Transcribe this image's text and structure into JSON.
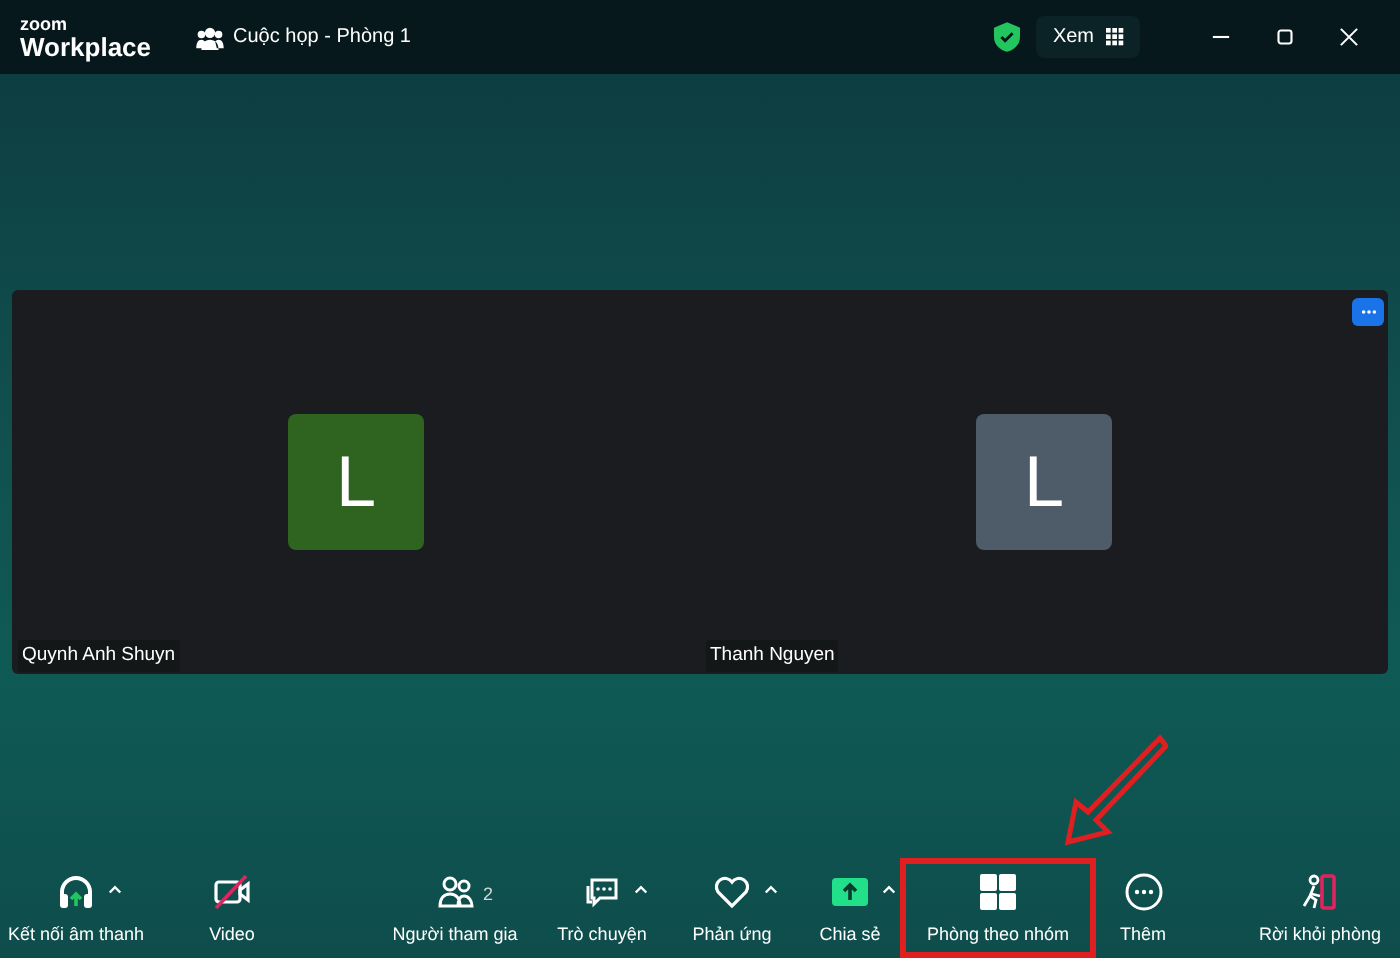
{
  "app": {
    "logo_top": "zoom",
    "logo_bottom": "Workplace",
    "meeting_title": "Cuộc họp - Phòng 1",
    "view_button": "Xem"
  },
  "participants": [
    {
      "initial": "L",
      "name": "Quynh Anh Shuyn",
      "color": "#2f6420"
    },
    {
      "initial": "L",
      "name": "Thanh Nguyen",
      "color": "#4d5c68"
    }
  ],
  "toolbar": [
    {
      "kind": "audio",
      "label": "Kết nối âm thanh",
      "caret": true,
      "highlighted": false
    },
    {
      "kind": "video",
      "label": "Video",
      "off": true,
      "caret": false,
      "highlighted": false
    },
    {
      "kind": "participants",
      "label": "Người tham gia",
      "count": "2",
      "caret": false,
      "highlighted": false
    },
    {
      "kind": "chat",
      "label": "Trò chuyện",
      "caret": true,
      "highlighted": false
    },
    {
      "kind": "react",
      "label": "Phản ứng",
      "caret": true,
      "highlighted": false
    },
    {
      "kind": "share",
      "label": "Chia sẻ",
      "caret": true,
      "highlighted": false
    },
    {
      "kind": "rooms",
      "label": "Phòng theo nhóm",
      "caret": false,
      "highlighted": true
    },
    {
      "kind": "more",
      "label": "Thêm",
      "caret": false,
      "highlighted": false
    },
    {
      "kind": "leave",
      "label": "Rời khỏi phòng",
      "caret": false,
      "highlighted": false
    }
  ]
}
